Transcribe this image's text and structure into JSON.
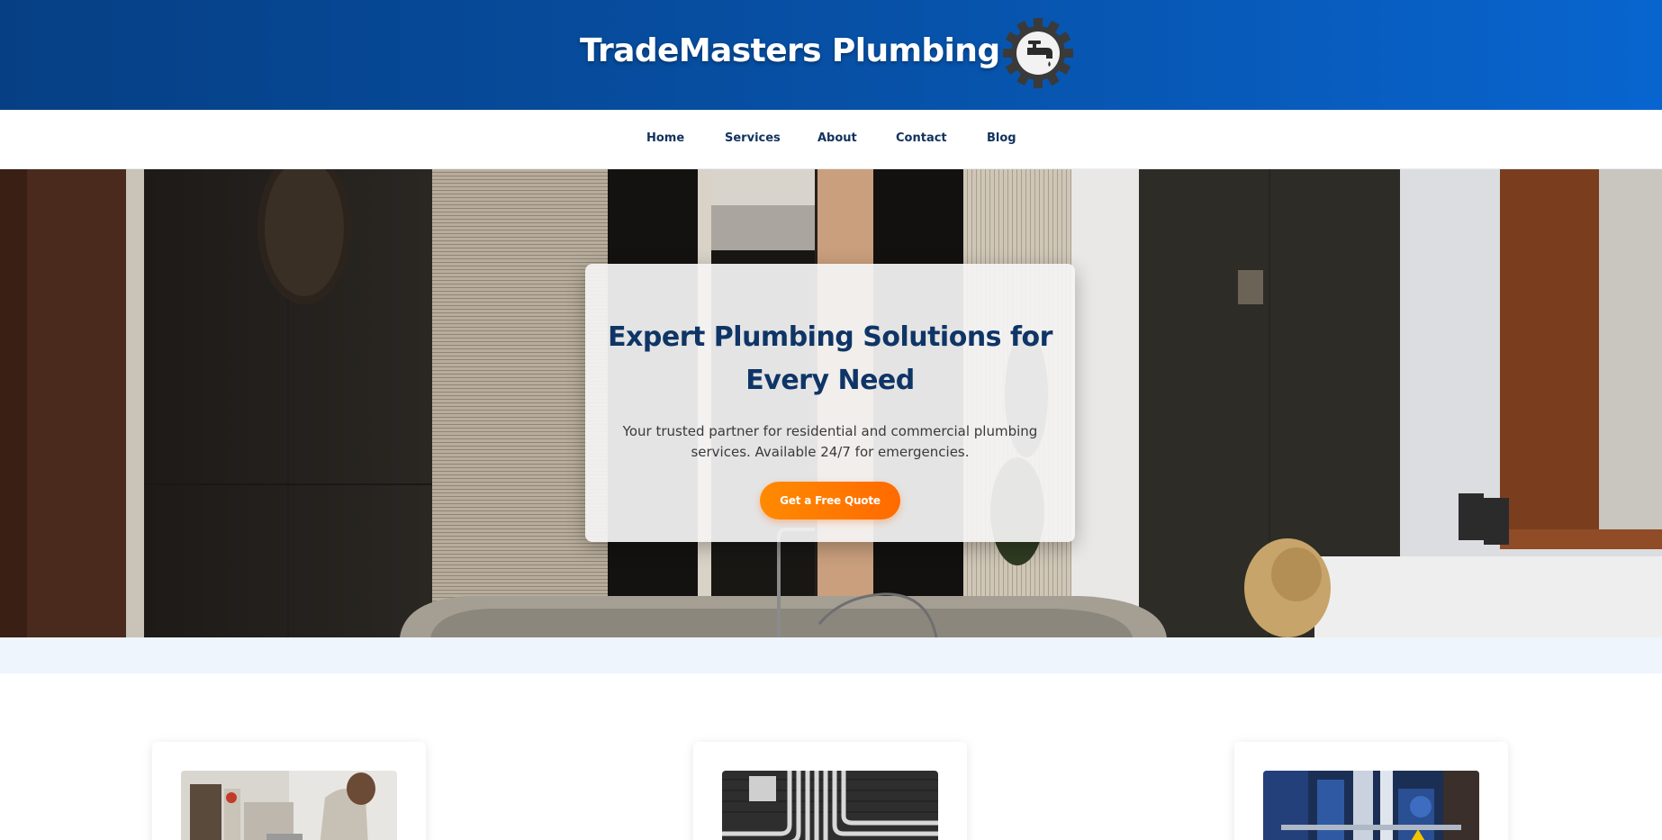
{
  "brand": {
    "title": "TradeMasters Plumbing",
    "logo_icon": "faucet-gear-icon"
  },
  "nav": {
    "items": [
      {
        "label": "Home"
      },
      {
        "label": "Services"
      },
      {
        "label": "About"
      },
      {
        "label": "Contact"
      },
      {
        "label": "Blog"
      }
    ]
  },
  "hero": {
    "title": "Expert Plumbing Solutions for Every Need",
    "subtitle": "Your trusted partner for residential and commercial plumbing services. Available 24/7 for emergencies.",
    "cta_label": "Get a Free Quote",
    "background_image": "bathroom-with-stone-bathtub"
  },
  "services": {
    "cards": [
      {
        "image": "technician-at-sink-photo"
      },
      {
        "image": "wall-pipes-black-white-photo"
      },
      {
        "image": "industrial-blue-valves-photo"
      }
    ]
  },
  "colors": {
    "header_start": "#063f84",
    "header_end": "#0865cf",
    "nav_text": "#12325e",
    "hero_title": "#0f3566",
    "cta_start": "#ff8a00",
    "cta_end": "#ff6a00",
    "strip": "#eef5fd"
  }
}
